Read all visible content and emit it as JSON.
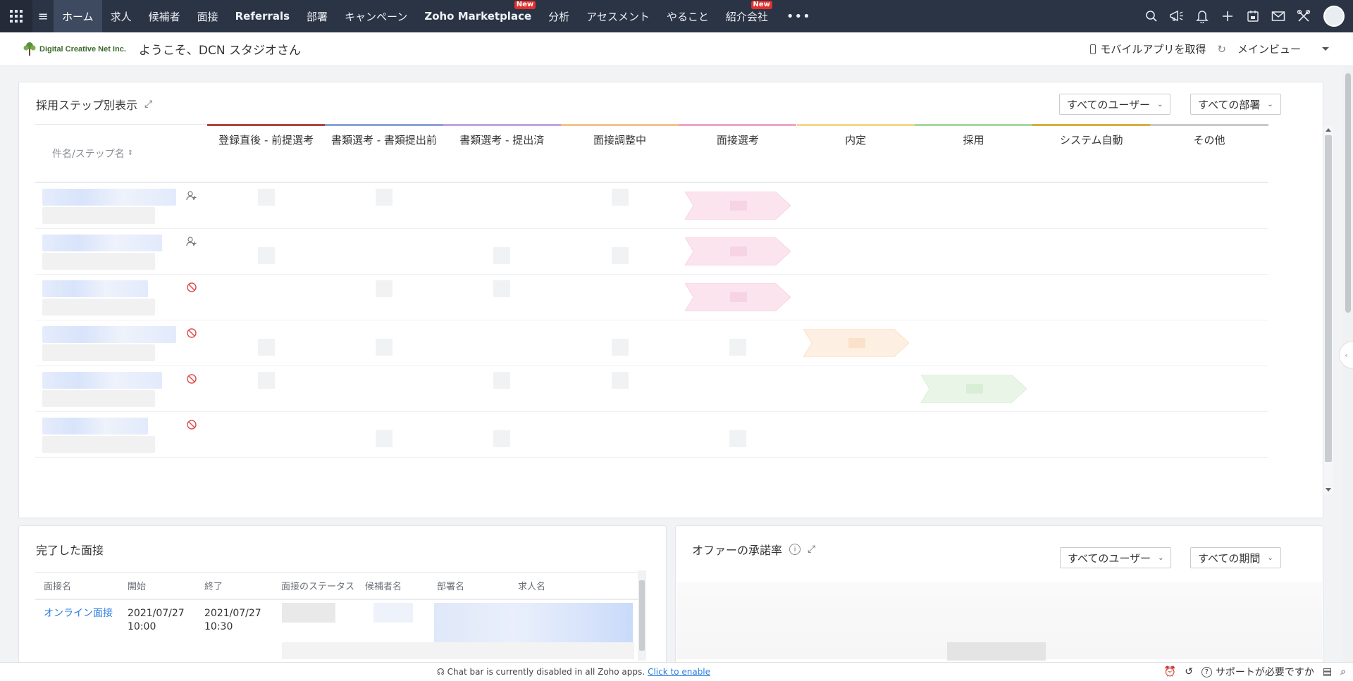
{
  "topnav": {
    "items": [
      {
        "label": "ホーム",
        "active": true
      },
      {
        "label": "求人"
      },
      {
        "label": "候補者"
      },
      {
        "label": "面接"
      },
      {
        "label": "Referrals",
        "bold": true
      },
      {
        "label": "部署"
      },
      {
        "label": "キャンペーン"
      },
      {
        "label": "Zoho Marketplace",
        "bold": true,
        "badge": "New"
      },
      {
        "label": "分析"
      },
      {
        "label": "アセスメント"
      },
      {
        "label": "やること"
      },
      {
        "label": "紹介会社",
        "badge": "New"
      }
    ],
    "more": "•••",
    "icons": [
      "search-icon",
      "announcement-icon",
      "bell-icon",
      "plus-icon",
      "calendar-icon",
      "mail-icon",
      "tools-icon"
    ]
  },
  "welcome": {
    "logo_text": "Digital Creative Net Inc.",
    "greeting": "ようこそ、DCN スタジオさん",
    "mobile_app": "モバイルアプリを取得",
    "view": "メインビュー"
  },
  "pipeline": {
    "title": "採用ステップ別表示",
    "user_filter": "すべてのユーザー",
    "dept_filter": "すべての部署",
    "name_header": "件名/ステップ名",
    "steps": [
      {
        "label": "登録直後 - 前提選考",
        "color": "#b0473f"
      },
      {
        "label": "書類選考 - 書類提出前",
        "color": "#8fa3d8"
      },
      {
        "label": "書類選考 - 提出済",
        "color": "#c3a6dc"
      },
      {
        "label": "面接調整中",
        "color": "#f1c48c"
      },
      {
        "label": "面接選考",
        "color": "#f0a6c4"
      },
      {
        "label": "内定",
        "color": "#f3d98c"
      },
      {
        "label": "採用",
        "color": "#a7d9a0"
      },
      {
        "label": "システム自動",
        "color": "#d6b042"
      },
      {
        "label": "その他",
        "color": "#c9c9c9"
      }
    ],
    "rows": [
      {
        "icon": "add-user-icon",
        "stage_index": 4
      },
      {
        "icon": "add-user-icon",
        "stage_index": 4
      },
      {
        "icon": "blocked-icon",
        "stage_index": 4
      },
      {
        "icon": "blocked-icon",
        "stage_index": 5
      },
      {
        "icon": "blocked-icon",
        "stage_index": 6
      },
      {
        "icon": "blocked-icon",
        "stage_index": -1
      }
    ]
  },
  "interviews": {
    "title": "完了した面接",
    "columns": [
      "面接名",
      "開始",
      "終了",
      "面接のステータス",
      "候補者名",
      "部署名",
      "求人名"
    ],
    "rows": [
      {
        "name": "オンライン面接",
        "start": "2021/07/27 10:00",
        "end": "2021/07/27 10:30"
      }
    ]
  },
  "offer": {
    "title": "オファーの承諾率",
    "user_filter": "すべてのユーザー",
    "period_filter": "すべての期間"
  },
  "footer": {
    "chat_text": "Chat bar is currently disabled in all Zoho apps.",
    "chat_link": "Click to enable",
    "support": "サポートが必要ですか"
  }
}
